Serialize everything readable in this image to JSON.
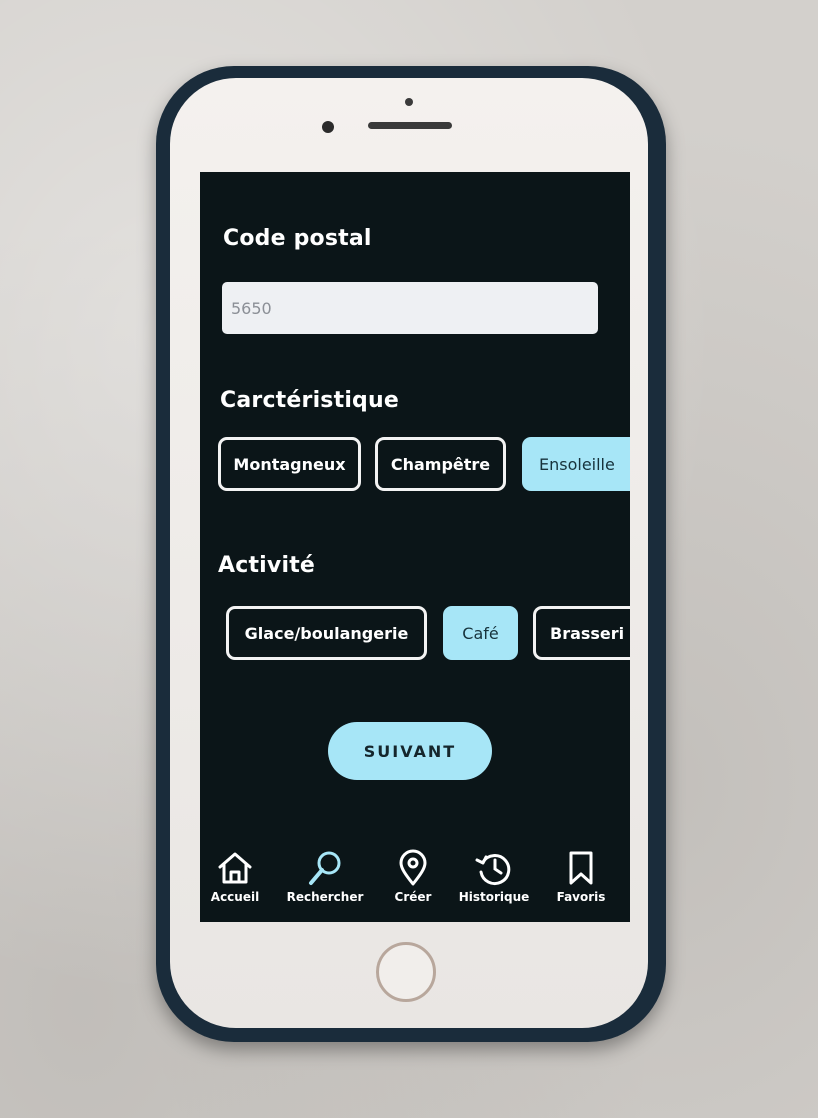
{
  "form": {
    "postal_code_label": "Code postal",
    "postal_code_value": "5650",
    "characteristic_label": "Carctéristique",
    "characteristic_options": [
      {
        "label": "Montagneux",
        "selected": false
      },
      {
        "label": "Champêtre",
        "selected": false
      },
      {
        "label": "Ensoleille",
        "selected": true
      }
    ],
    "activity_label": "Activité",
    "activity_options": [
      {
        "label": "Glace/boulangerie",
        "selected": false
      },
      {
        "label": "Café",
        "selected": true
      },
      {
        "label": "Brasseri",
        "selected": false
      }
    ],
    "next_button": "SUIVANT"
  },
  "nav": {
    "items": [
      {
        "label": "Accueil",
        "icon": "home-icon"
      },
      {
        "label": "Rechercher",
        "icon": "search-icon"
      },
      {
        "label": "Créer",
        "icon": "location-pin-icon"
      },
      {
        "label": "Historique",
        "icon": "history-icon"
      },
      {
        "label": "Favoris",
        "icon": "bookmark-icon"
      }
    ]
  },
  "colors": {
    "screen_background": "#0b1518",
    "accent": "#a7e6f7",
    "phone_case": "#1a2c3b"
  }
}
